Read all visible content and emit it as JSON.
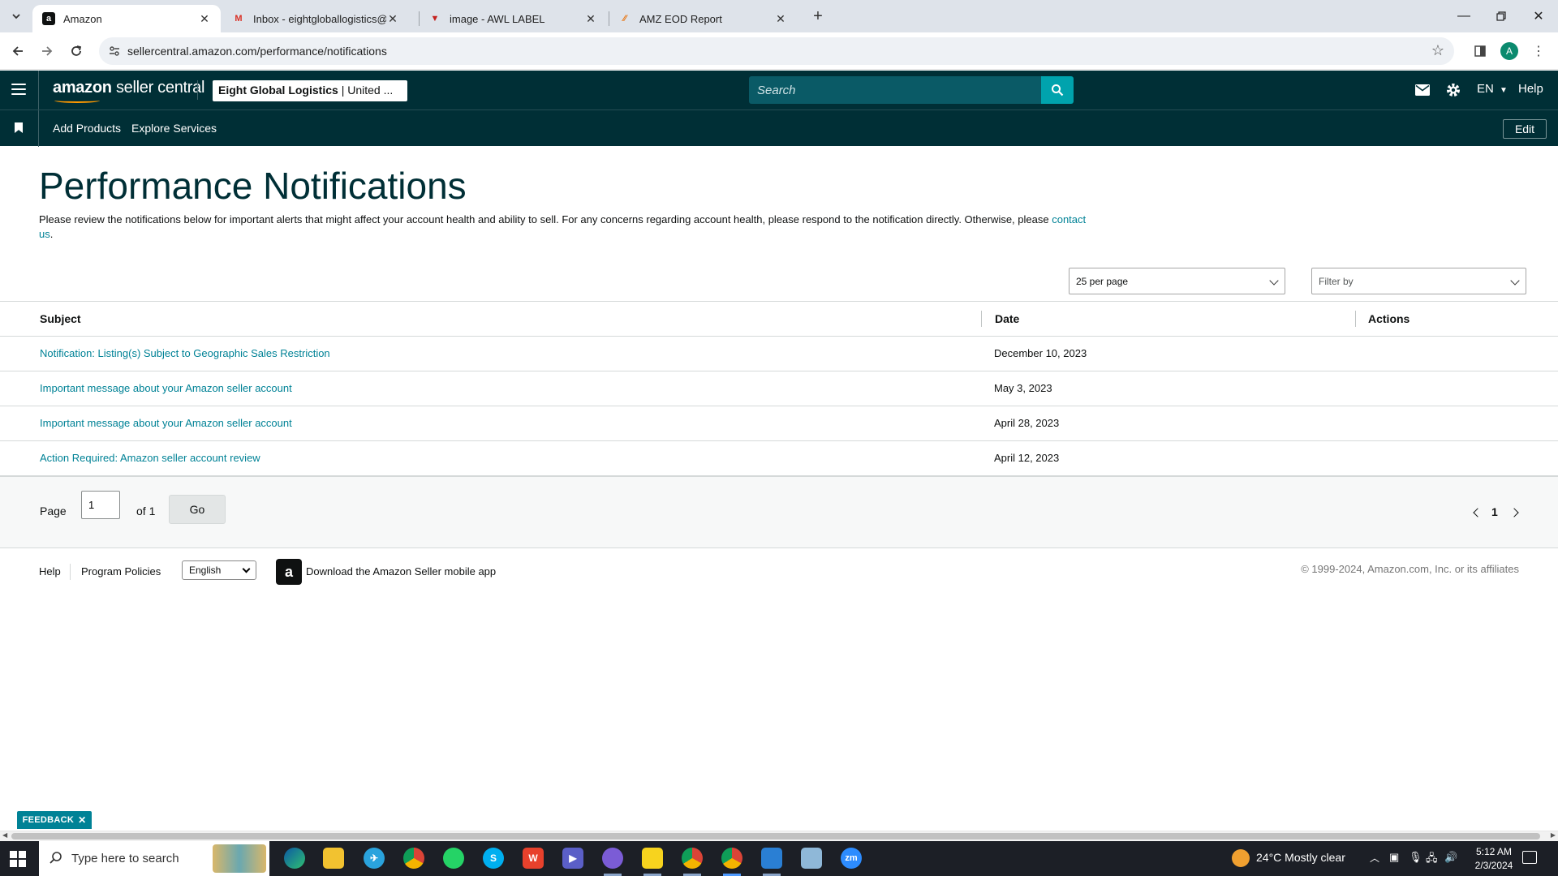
{
  "browser": {
    "tabs": [
      {
        "title": "Amazon",
        "favicon": "a"
      },
      {
        "title": "Inbox - eightgloballogistics@gm",
        "favicon": "M"
      },
      {
        "title": "image - AWL LABEL",
        "favicon": "▼"
      },
      {
        "title": "AMZ EOD Report",
        "favicon": "⁄⁄"
      }
    ],
    "url": "sellercentral.amazon.com/performance/notifications",
    "profile_initial": "A"
  },
  "header": {
    "logo_brand": "amazon",
    "logo_product": "seller central",
    "account_name": "Eight Global Logistics",
    "account_region": "| United ...",
    "search_placeholder": "Search",
    "language": "EN",
    "help": "Help"
  },
  "subnav": {
    "items": [
      "Add Products",
      "Explore Services"
    ],
    "edit": "Edit"
  },
  "main": {
    "title": "Performance Notifications",
    "intro_text": "Please review the notifications below for important alerts that might affect your account health and ability to sell. For any concerns regarding account health, please respond to the notification directly. Otherwise, please",
    "intro_link": "contact us",
    "intro_end": ".",
    "per_page": "25 per page",
    "filter_placeholder": "Filter by"
  },
  "table": {
    "columns": [
      "Subject",
      "Date",
      "Actions"
    ],
    "rows": [
      {
        "subject": "Notification: Listing(s) Subject to Geographic Sales Restriction",
        "date": "December 10, 2023"
      },
      {
        "subject": "Important message about your Amazon seller account",
        "date": "May 3, 2023"
      },
      {
        "subject": "Important message about your Amazon seller account",
        "date": "April 28, 2023"
      },
      {
        "subject": "Action Required: Amazon seller account review",
        "date": "April 12, 2023"
      }
    ]
  },
  "pager": {
    "page_label": "Page",
    "current_page": "1",
    "of_label": "of 1",
    "go": "Go",
    "page_number": "1"
  },
  "footer": {
    "help": "Help",
    "program_policies": "Program Policies",
    "language": "English",
    "app_text": "Download the Amazon Seller mobile app",
    "copyright": "© 1999-2024, Amazon.com, Inc. or its affiliates"
  },
  "feedback": "FEEDBACK",
  "taskbar": {
    "search_placeholder": "Type here to search",
    "weather": "24°C  Mostly clear",
    "time": "5:12 AM",
    "date": "2/3/2024"
  },
  "colors": {
    "header_bg": "#002f36",
    "link": "#008296",
    "search_btn": "#00a3ad"
  }
}
